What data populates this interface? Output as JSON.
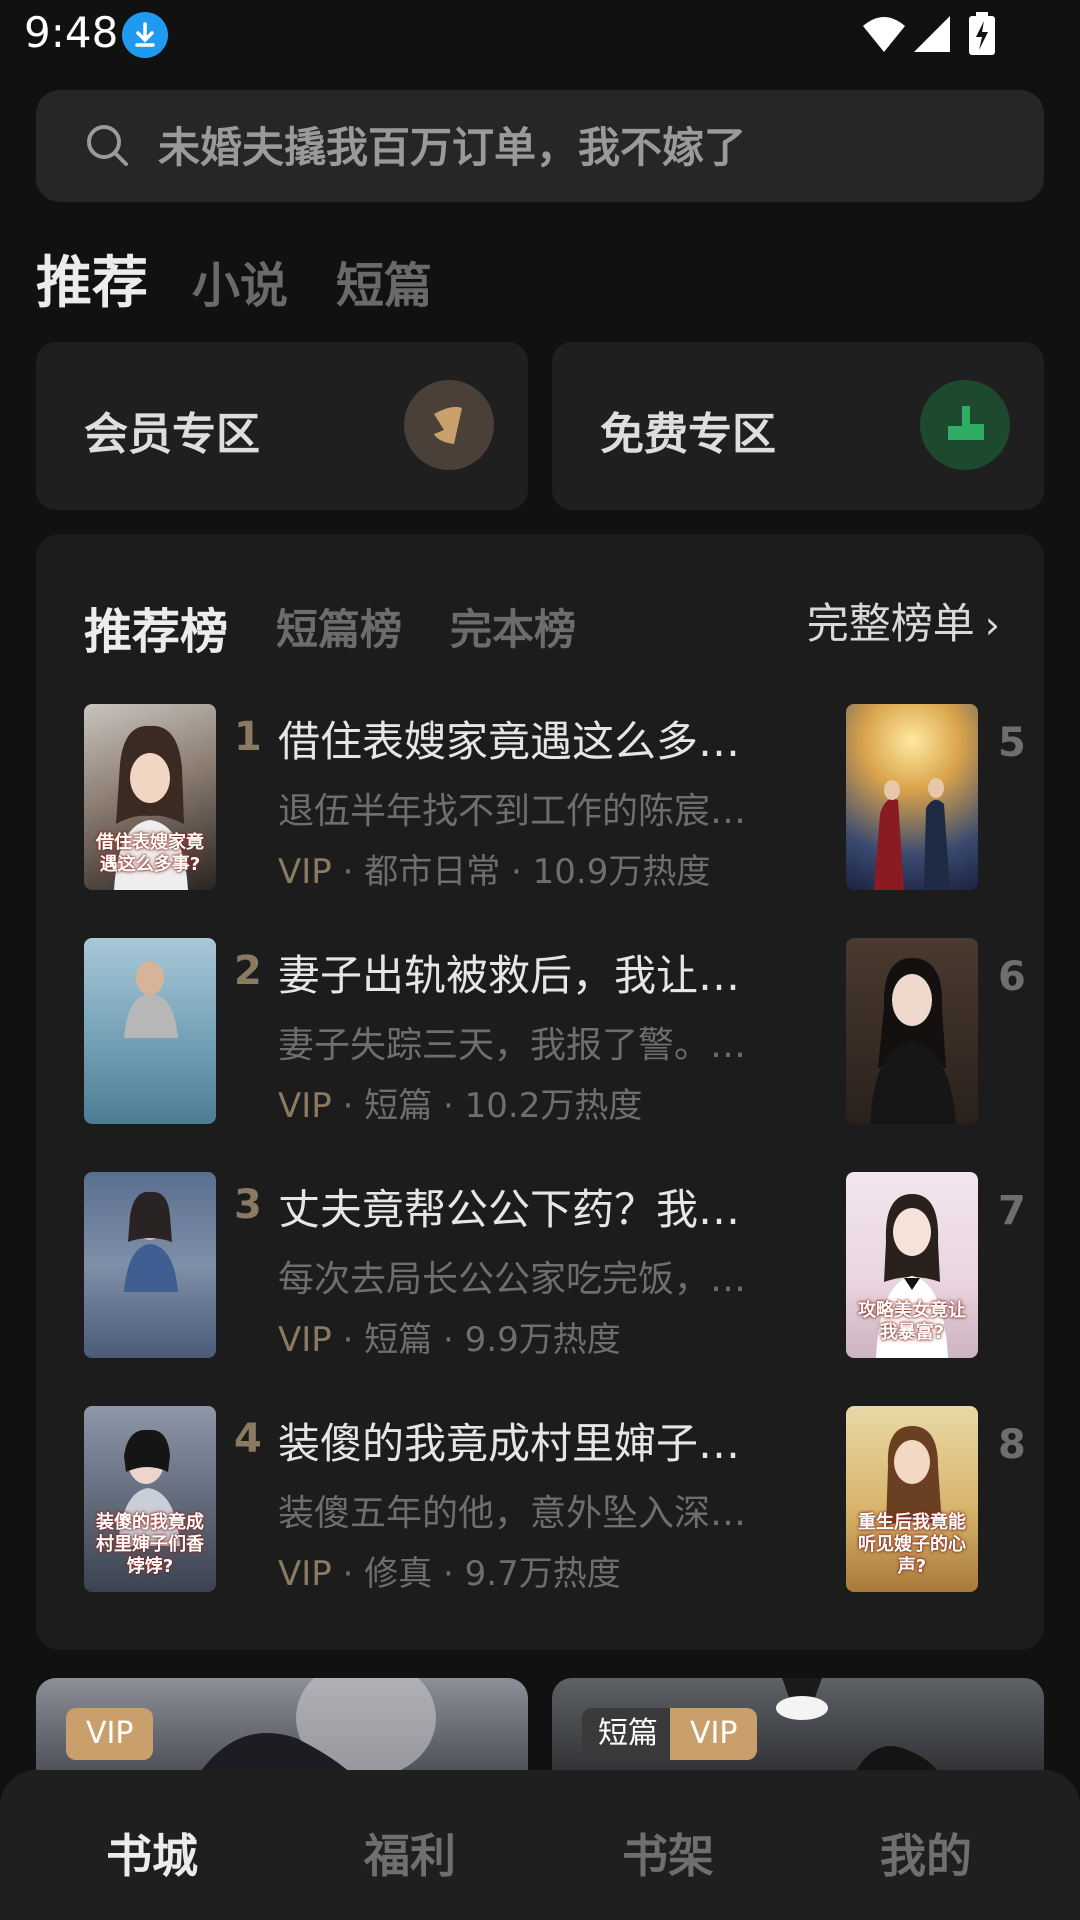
{
  "status_bar": {
    "time": "9:48"
  },
  "search": {
    "placeholder": "未婚夫撬我百万订单，我不嫁了"
  },
  "tabs": [
    {
      "label": "推荐"
    },
    {
      "label": "小说"
    },
    {
      "label": "短篇"
    }
  ],
  "zones": [
    {
      "label": "会员专区"
    },
    {
      "label": "免费专区"
    }
  ],
  "ranking": {
    "tabs": [
      {
        "label": "推荐榜"
      },
      {
        "label": "短篇榜"
      },
      {
        "label": "完本榜"
      }
    ],
    "full_list_label": "完整榜单",
    "items": [
      {
        "rank": "1",
        "title": "借住表嫂家竟遇这么多事...",
        "desc": "退伍半年找不到工作的陈宸投...",
        "vip": "VIP",
        "sep": "·",
        "category": "都市日常",
        "heat": "10.9万热度",
        "cover_text": "借住表嫂家竟遇这么多事?"
      },
      {
        "rank": "2",
        "title": "妻子出轨被救后，我让她...",
        "desc": "妻子失踪三天，我报了警。警...",
        "vip": "VIP",
        "sep": "·",
        "category": "短篇",
        "heat": "10.2万热度",
        "cover_text": ""
      },
      {
        "rank": "3",
        "title": "丈夫竟帮公公下药？我录...",
        "desc": "每次去局长公公家吃完饭，我...",
        "vip": "VIP",
        "sep": "·",
        "category": "短篇",
        "heat": "9.9万热度",
        "cover_text": ""
      },
      {
        "rank": "4",
        "title": "装傻的我竟成村里婶子们...",
        "desc": "装傻五年的他，意外坠入深潭...",
        "vip": "VIP",
        "sep": "·",
        "category": "修真",
        "heat": "9.7万热度",
        "cover_text": "装傻的我竟成村里婶子们香饽饽?"
      }
    ],
    "side_items": [
      {
        "rank": "5",
        "cover_text": ""
      },
      {
        "rank": "6",
        "cover_text": ""
      },
      {
        "rank": "7",
        "cover_text": "攻略美女竟让我暴富?"
      },
      {
        "rank": "8",
        "cover_text": "重生后我竟能听见嫂子的心声?"
      }
    ]
  },
  "promos": [
    {
      "badge_vip": "VIP"
    },
    {
      "badge_short": "短篇",
      "badge_vip": "VIP"
    }
  ],
  "nav": [
    {
      "label": "书城"
    },
    {
      "label": "福利"
    },
    {
      "label": "书架"
    },
    {
      "label": "我的"
    }
  ],
  "colors": {
    "background": "#111111",
    "card": "#1c1c1c",
    "accent_gold": "#8a7a62",
    "vip_badge": "#c9a06c"
  }
}
